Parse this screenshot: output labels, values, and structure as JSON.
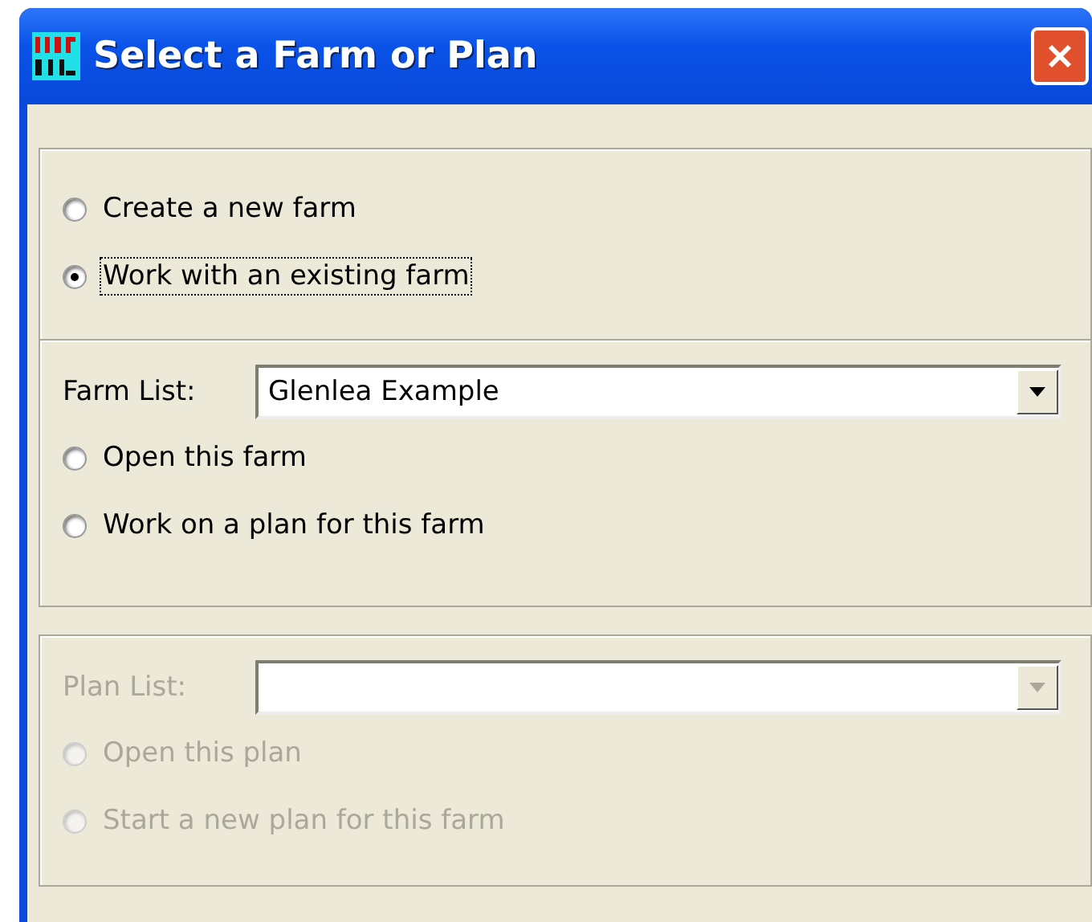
{
  "window": {
    "title": "Select a Farm or Plan"
  },
  "mode_options": [
    {
      "label": "Create a new farm",
      "selected": false,
      "focused": false
    },
    {
      "label": "Work with an existing farm",
      "selected": true,
      "focused": true
    }
  ],
  "farm_section": {
    "list_label": "Farm List:",
    "list_value": "Glenlea Example",
    "disabled": false,
    "options": [
      {
        "label": "Open this farm",
        "selected": false
      },
      {
        "label": "Work on a plan for this farm",
        "selected": false
      }
    ]
  },
  "plan_section": {
    "list_label": "Plan List:",
    "disabled": true,
    "options": [
      {
        "label": "Open this plan",
        "selected": false
      },
      {
        "label": "Start a new plan for this farm",
        "selected": false
      }
    ]
  }
}
